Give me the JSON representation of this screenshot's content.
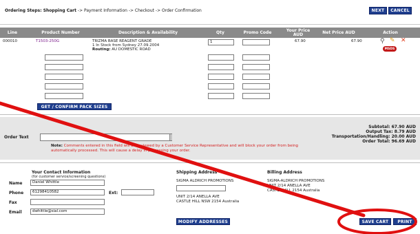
{
  "header": {
    "steps_current": "Ordering Steps: Shopping Cart",
    "steps_rest": " -> Payment Information -> Checkout -> Order Confirmation",
    "next_label": "NEXT",
    "cancel_label": "CANCEL"
  },
  "table": {
    "columns": [
      "Line",
      "Product Number",
      "Description & Availability",
      "Qty",
      "Promo Code",
      "Your Price AUD",
      "Net Price AUD",
      "Action"
    ],
    "row": {
      "line": "000010",
      "product": "T1503-250G",
      "desc1": "TRIZMA BASE REAGENT GRADE",
      "desc2": "1 In Stock from Sydney 27.09.2004",
      "routing_label": "Routing:",
      "routing_value": " AU DOMESTIC ROAD",
      "qty": "1",
      "your_price": "67.90",
      "net_price": "67.90",
      "msds_label": "MSDS"
    },
    "get_confirm_label": "GET / CONFIRM PACK SIZES"
  },
  "order_text": {
    "label": "Order Text",
    "note_label": "Note:",
    "note_text": "Comments entered in this field will be reviewed by a Customer Service Representative and will block your order from being automatically processed. This will cause a delay in processing your order."
  },
  "totals": {
    "subtotal": "Subtotal: 67.90 AUD",
    "output_tax": "Output Tax: 8.79 AUD",
    "transport": "Transportation/Handling: 20.00 AUD",
    "order_total": "Order Total: 96.69 AUD"
  },
  "contact": {
    "title": "Your Contact Information",
    "subtitle": "(for customer service/screening questions)",
    "name_label": "Name",
    "name_value": "Daniel Whittle",
    "phone_label": "Phone",
    "phone_value": "61298410582",
    "ext_label": "Ext:",
    "fax_label": "Fax",
    "email_label": "Email",
    "email_value": "dwhittle@sial.com"
  },
  "shipping": {
    "title": "Shipping Address",
    "line1": "SIGMA ALDRICH PROMOTIONS",
    "line2": "UNIT 2/14 ANELLA AVE",
    "line3": "CASTLE HILL NSW 2154  Australia"
  },
  "billing": {
    "title": "Billing Address",
    "line1": "SIGMA-ALDRICH PROMOTIONS",
    "line2": "UNIT 2/14 ANELLA AVE",
    "line3": "CASTLE HILL 2154  Australia"
  },
  "footer": {
    "modify_label": "MODIFY ADDRESSES",
    "save_cart_label": "SAVE CART",
    "print_label": "PRINT"
  },
  "annotation_color": "#e01010"
}
